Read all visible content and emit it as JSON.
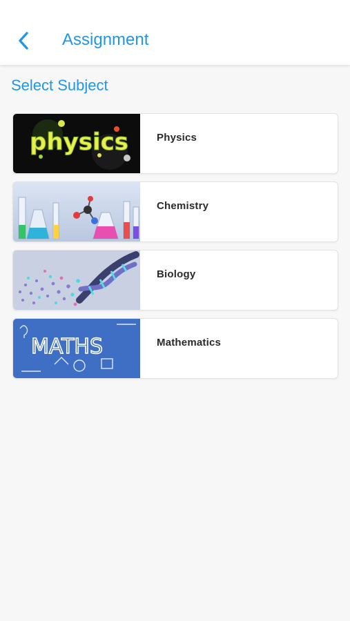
{
  "header": {
    "title": "Assignment",
    "back_icon": "chevron-left-icon",
    "accent_color": "#2196e9"
  },
  "section": {
    "title": "Select Subject"
  },
  "subjects": [
    {
      "name": "Physics",
      "thumbnail_text": "physics"
    },
    {
      "name": "Chemistry"
    },
    {
      "name": "Biology"
    },
    {
      "name": "Mathematics",
      "thumbnail_text": "MATHS"
    }
  ]
}
